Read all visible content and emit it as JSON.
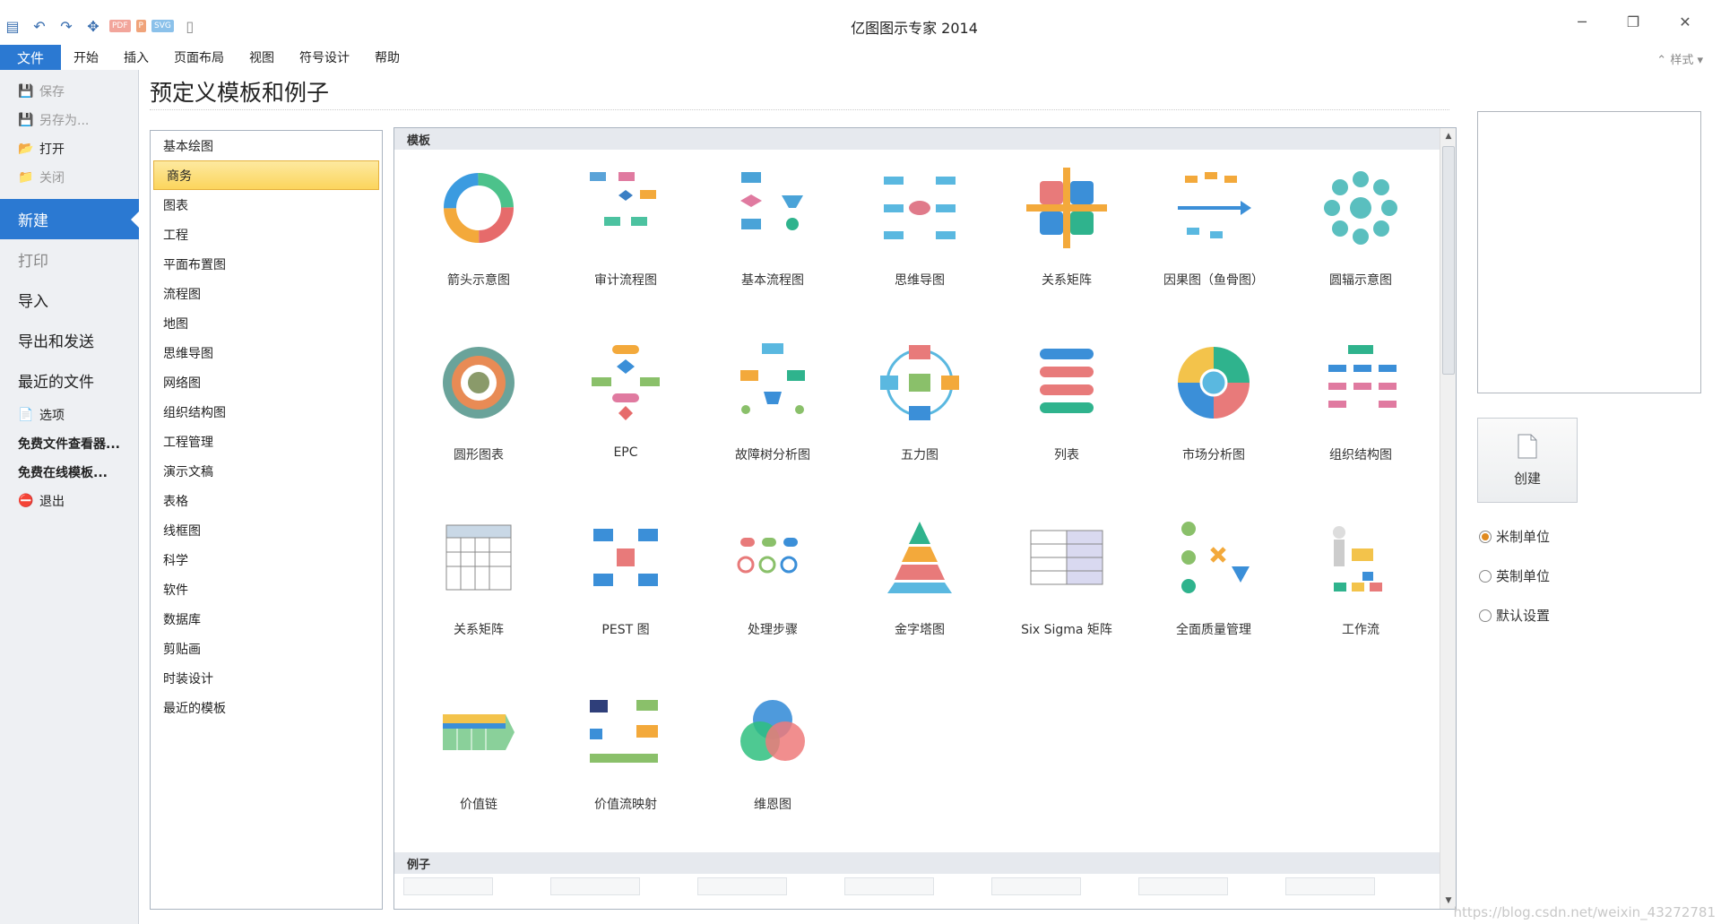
{
  "window": {
    "title": "亿图图示专家 2014",
    "minimize_icon": "minimize-icon",
    "restore_icon": "restore-icon",
    "close_icon": "close-icon"
  },
  "qat": {
    "icons": [
      "app-icon",
      "undo-icon",
      "redo-icon",
      "move-icon",
      "pdf-icon",
      "ppt-icon",
      "svg-icon",
      "new-doc-icon"
    ],
    "pdf_label": "PDF",
    "ppt_label": "P",
    "svg_label": "SVG"
  },
  "menu": {
    "file": "文件",
    "items": [
      "开始",
      "插入",
      "页面布局",
      "视图",
      "符号设计",
      "帮助"
    ],
    "style": "样式"
  },
  "backstage": {
    "save": "保存",
    "save_as": "另存为...",
    "open": "打开",
    "close": "关闭",
    "new": "新建",
    "print": "打印",
    "import": "导入",
    "export": "导出和发送",
    "recent": "最近的文件",
    "options": "选项",
    "free_viewer": "免费文件查看器...",
    "free_templates": "免费在线模板...",
    "exit": "退出"
  },
  "heading": "预定义模板和例子",
  "categories": [
    "基本绘图",
    "商务",
    "图表",
    "工程",
    "平面布置图",
    "流程图",
    "地图",
    "思维导图",
    "网络图",
    "组织结构图",
    "工程管理",
    "演示文稿",
    "表格",
    "线框图",
    "科学",
    "软件",
    "数据库",
    "剪贴画",
    "时装设计",
    "最近的模板"
  ],
  "selected_category": "商务",
  "gallery": {
    "templates_header": "模板",
    "examples_header": "例子",
    "templates": [
      "箭头示意图",
      "审计流程图",
      "基本流程图",
      "思维导图",
      "关系矩阵",
      "因果图（鱼骨图）",
      "圆辐示意图",
      "圆形图表",
      "EPC",
      "故障树分析图",
      "五力图",
      "列表",
      "市场分析图",
      "组织结构图",
      "关系矩阵",
      "PEST 图",
      "处理步骤",
      "金字塔图",
      "Six Sigma 矩阵",
      "全面质量管理",
      "工作流",
      "价值链",
      "价值流映射",
      "维恩图"
    ]
  },
  "right": {
    "create": "创建",
    "units": [
      "米制单位",
      "英制单位",
      "默认设置"
    ],
    "selected_unit": "米制单位"
  },
  "watermark": "https://blog.csdn.net/weixin_43272781"
}
